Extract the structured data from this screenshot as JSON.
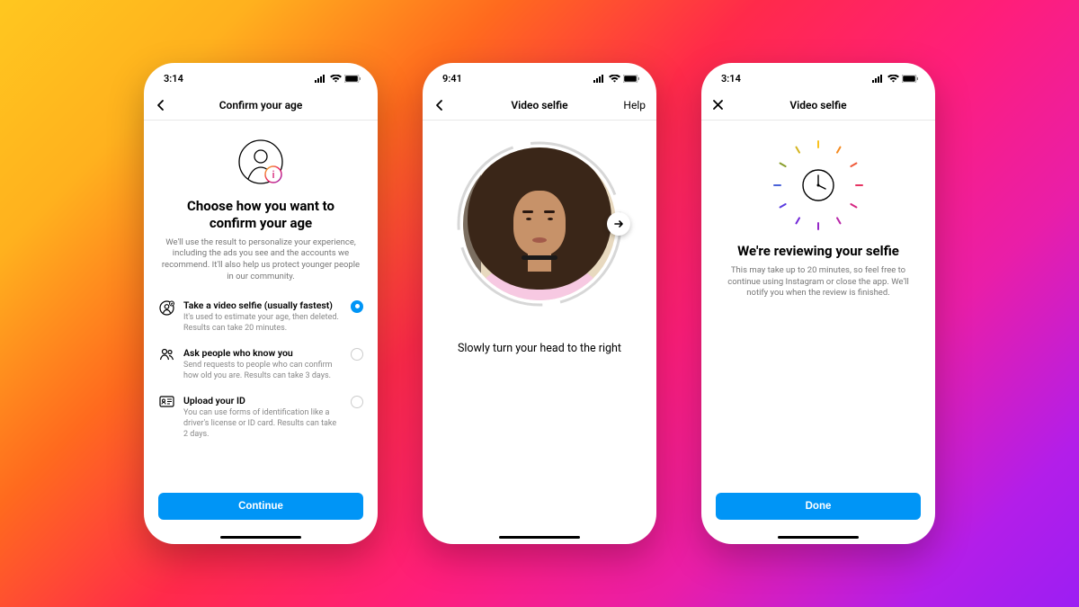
{
  "status": {
    "time1": "3:14",
    "time2": "9:41",
    "time3": "3:14"
  },
  "screen1": {
    "title": "Confirm your age",
    "heading": "Choose how you want to confirm your age",
    "subtext": "We'll use the result to personalize your experience, including the ads you see and the accounts we recommend. It'll also help us protect younger people in our community.",
    "options": [
      {
        "title": "Take a video selfie (usually fastest)",
        "desc": "It's used to estimate your age, then deleted. Results can take 20 minutes."
      },
      {
        "title": "Ask people who know you",
        "desc": "Send requests to people who can confirm how old you are. Results can take 3 days."
      },
      {
        "title": "Upload your ID",
        "desc": "You can use forms of identification like a driver's license or ID card. Results can take 2 days."
      }
    ],
    "cta": "Continue"
  },
  "screen2": {
    "title": "Video selfie",
    "help": "Help",
    "instruction": "Slowly turn your head to the right"
  },
  "screen3": {
    "title": "Video selfie",
    "heading": "We're reviewing your selfie",
    "subtext": "This may take up to 20 minutes, so feel free to continue using Instagram or close the app. We'll notify you when the review is finished.",
    "cta": "Done"
  }
}
